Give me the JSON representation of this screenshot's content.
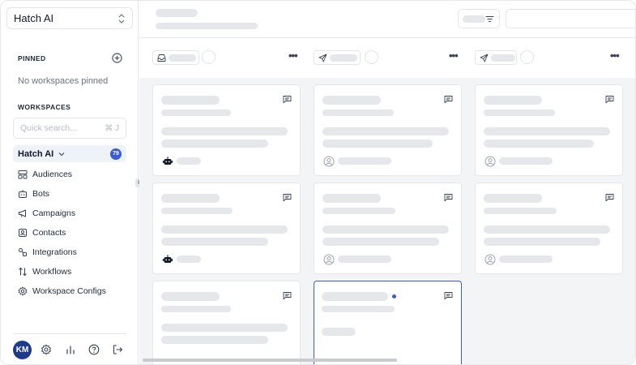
{
  "sidebar": {
    "workspace_name": "Hatch AI",
    "pinned_title": "PINNED",
    "no_pinned_text": "No workspaces pinned",
    "workspaces_title": "WORKSPACES",
    "search_placeholder": "Quick search...",
    "search_shortcut": "⌘ J",
    "current_workspace": "Hatch AI",
    "current_workspace_badge": "79",
    "nav_items": [
      {
        "label": "Audiences",
        "icon": "audiences-icon"
      },
      {
        "label": "Bots",
        "icon": "bot-icon"
      },
      {
        "label": "Campaigns",
        "icon": "megaphone-icon"
      },
      {
        "label": "Contacts",
        "icon": "contacts-icon"
      },
      {
        "label": "Integrations",
        "icon": "integrations-icon"
      },
      {
        "label": "Workflows",
        "icon": "workflows-icon"
      },
      {
        "label": "Workspace Configs",
        "icon": "gear-icon"
      }
    ],
    "avatar_initials": "KM",
    "footer_icons": [
      "settings-icon",
      "analytics-icon",
      "help-icon",
      "logout-icon"
    ]
  },
  "board": {
    "columns": [
      {
        "icon": "inbox-icon"
      },
      {
        "icon": "send-icon"
      },
      {
        "icon": "send-icon"
      }
    ]
  },
  "colors": {
    "accent": "#3b5bdb",
    "avatar_bg": "#1e3a8a",
    "skeleton": "#e5e7eb",
    "board_bg": "#f3f4f6"
  }
}
